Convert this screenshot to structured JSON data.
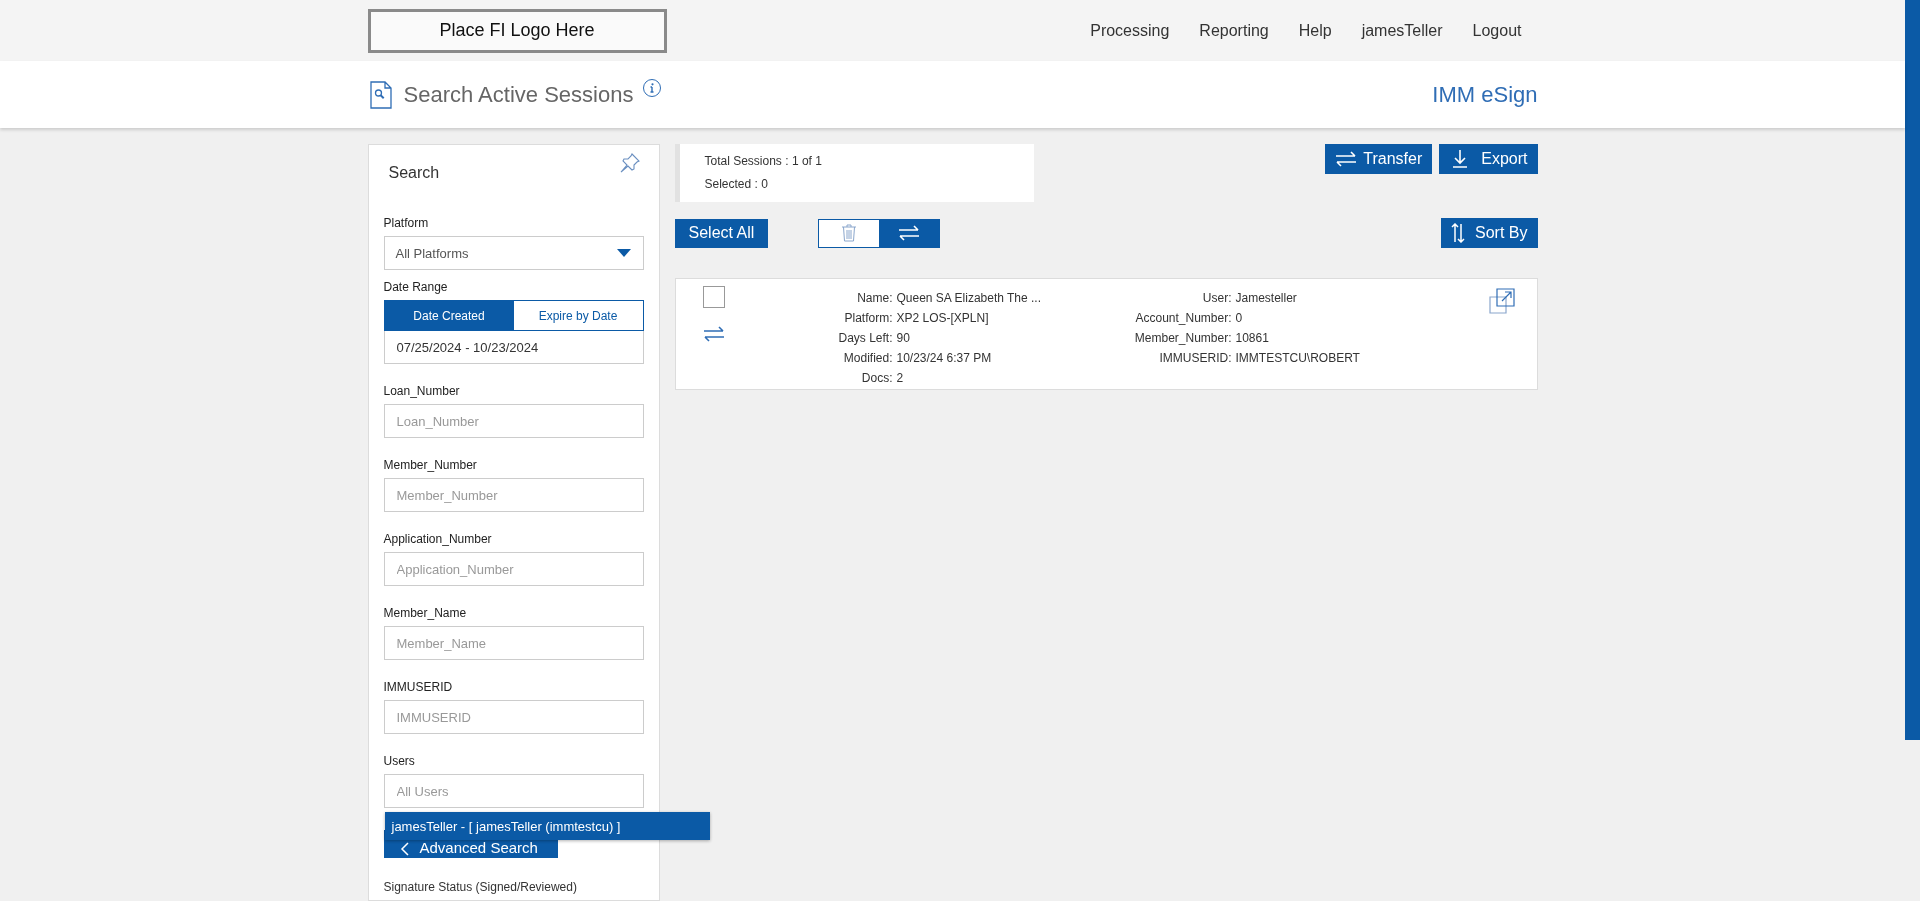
{
  "header": {
    "logo": "Place FI Logo Here",
    "nav": [
      {
        "label": "Processing"
      },
      {
        "label": "Reporting"
      },
      {
        "label": "Help"
      },
      {
        "label": "jamesTeller"
      },
      {
        "label": "Logout"
      }
    ]
  },
  "subheader": {
    "title": "Search Active Sessions",
    "brand": "IMM eSign"
  },
  "search_panel": {
    "title": "Search",
    "fields": [
      {
        "kind": "select",
        "label": "Platform",
        "value": "All Platforms"
      },
      {
        "kind": "date_range",
        "label": "Date Range",
        "tabs": [
          {
            "label": "Date Created",
            "selected": true
          },
          {
            "label": "Expire by Date",
            "selected": false
          }
        ],
        "value": "07/25/2024 - 10/23/2024"
      },
      {
        "kind": "text",
        "label": "Loan_Number",
        "placeholder": "Loan_Number"
      },
      {
        "kind": "text",
        "label": "Member_Number",
        "placeholder": "Member_Number"
      },
      {
        "kind": "text",
        "label": "Application_Number",
        "placeholder": "Application_Number"
      },
      {
        "kind": "text",
        "label": "Member_Name",
        "placeholder": "Member_Name"
      },
      {
        "kind": "text",
        "label": "IMMUSERID",
        "placeholder": "IMMUSERID"
      },
      {
        "kind": "combo",
        "label": "Users",
        "placeholder": "All Users",
        "suggestions": [
          {
            "label": "jamesTeller - [ jamesTeller (immtestcu) ]",
            "selected": true
          }
        ]
      }
    ],
    "advanced_button": "Advanced Search",
    "signature_status_label": "Signature Status (Signed/Reviewed)"
  },
  "summary": {
    "total": "Total Sessions : 1 of 1",
    "selected": "Selected : 0"
  },
  "actions": {
    "transfer": "Transfer",
    "export": "Export",
    "select_all": "Select All",
    "sort_by": "Sort By"
  },
  "bulk_toggle": [
    {
      "kind": "delete",
      "selected": false
    },
    {
      "kind": "transfer",
      "selected": true
    }
  ],
  "sessions": [
    {
      "checked": false,
      "details_left": [
        {
          "label": "Name:",
          "value": "Queen SA Elizabeth The ..."
        },
        {
          "label": "Platform:",
          "value": "XP2 LOS-[XPLN]"
        },
        {
          "label": "Days Left:",
          "value": "90"
        },
        {
          "label": "Modified:",
          "value": "10/23/24 6:37 PM"
        },
        {
          "label": "Docs:",
          "value": "2"
        }
      ],
      "details_right": [
        {
          "label": "User:",
          "value": "Jamesteller"
        },
        {
          "label": "Account_Number:",
          "value": "0"
        },
        {
          "label": "Member_Number:",
          "value": "10861"
        },
        {
          "label": "IMMUSERID:",
          "value": "IMMTESTCU\\ROBERT"
        }
      ]
    }
  ]
}
